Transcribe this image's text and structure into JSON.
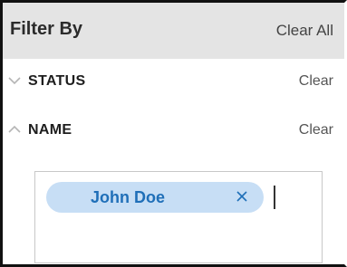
{
  "header": {
    "title": "Filter By",
    "clear_all_label": "Clear All"
  },
  "sections": [
    {
      "label": "STATUS",
      "clear_label": "Clear",
      "expanded": false
    },
    {
      "label": "NAME",
      "clear_label": "Clear",
      "expanded": true
    }
  ],
  "name_filter": {
    "chips": [
      {
        "label": "John Doe",
        "remove_icon": "close-icon"
      }
    ],
    "input_value": ""
  },
  "colors": {
    "header_bg": "#e4e4e4",
    "chip_bg": "#c7def5",
    "chip_text": "#1f6fb8"
  }
}
